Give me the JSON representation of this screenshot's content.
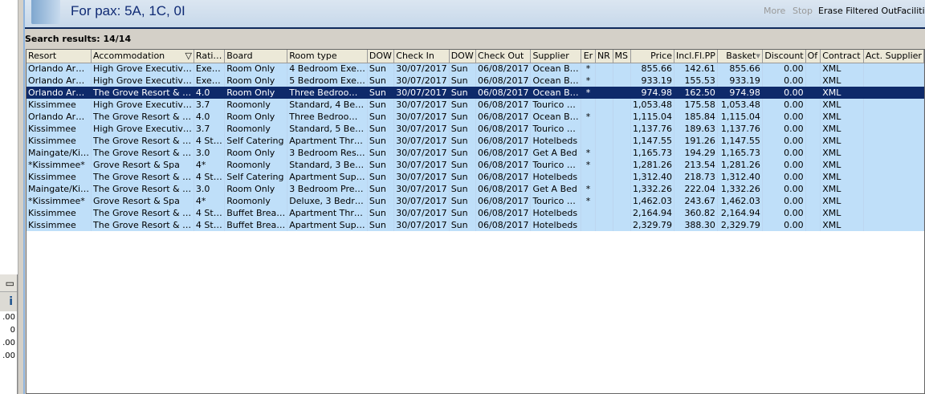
{
  "header": {
    "title": "For pax: 5A, 1C, 0I",
    "tools": [
      "More",
      "Stop",
      "Erase Filtered Out",
      "Facilities"
    ]
  },
  "results_label": "Search results: 14/14",
  "left_panel": {
    "values": [
      ".00",
      "0",
      ".00",
      ".00"
    ],
    "info_icon": "i"
  },
  "columns": [
    "Resort",
    "Accommodation",
    "Rati…",
    "Board",
    "Room type",
    "DOW",
    "Check In",
    "DOW",
    "Check Out",
    "Supplier",
    "Er",
    "NR",
    "MS",
    "Price",
    "Incl.Fl.PP",
    "Basket",
    "Discount",
    "Of",
    "Contract",
    "Act. Supplier"
  ],
  "rows": [
    [
      "Orlando Ar…",
      "High Grove Executiv…",
      "Exe…",
      "Room Only",
      "4 Bedroom Exe…",
      "Sun",
      "30/07/2017",
      "Sun",
      "06/08/2017",
      "Ocean B…",
      "*",
      "",
      "",
      "855.66",
      "142.61",
      "855.66",
      "0.00",
      "",
      "XML",
      ""
    ],
    [
      "Orlando Ar…",
      "High Grove Executiv…",
      "Exe…",
      "Room Only",
      "5 Bedroom Exe…",
      "Sun",
      "30/07/2017",
      "Sun",
      "06/08/2017",
      "Ocean B…",
      "*",
      "",
      "",
      "933.19",
      "155.53",
      "933.19",
      "0.00",
      "",
      "XML",
      ""
    ],
    [
      "Orlando Ar…",
      "The Grove Resort & …",
      "4.0",
      "Room Only",
      "Three Bedroo…",
      "Sun",
      "30/07/2017",
      "Sun",
      "06/08/2017",
      "Ocean B…",
      "*",
      "",
      "",
      "974.98",
      "162.50",
      "974.98",
      "0.00",
      "",
      "XML",
      ""
    ],
    [
      "Kissimmee",
      "High Grove Executiv…",
      "3.7",
      "Roomonly",
      "Standard, 4 Be…",
      "Sun",
      "30/07/2017",
      "Sun",
      "06/08/2017",
      "Tourico …",
      "",
      "",
      "",
      "1,053.48",
      "175.58",
      "1,053.48",
      "0.00",
      "",
      "XML",
      ""
    ],
    [
      "Orlando Ar…",
      "The Grove Resort & …",
      "4.0",
      "Room Only",
      "Three Bedroo…",
      "Sun",
      "30/07/2017",
      "Sun",
      "06/08/2017",
      "Ocean B…",
      "*",
      "",
      "",
      "1,115.04",
      "185.84",
      "1,115.04",
      "0.00",
      "",
      "XML",
      ""
    ],
    [
      "Kissimmee",
      "High Grove Executiv…",
      "3.7",
      "Roomonly",
      "Standard, 5 Be…",
      "Sun",
      "30/07/2017",
      "Sun",
      "06/08/2017",
      "Tourico …",
      "",
      "",
      "",
      "1,137.76",
      "189.63",
      "1,137.76",
      "0.00",
      "",
      "XML",
      ""
    ],
    [
      "Kissimmee",
      "The Grove Resort & …",
      "4 St…",
      "Self Catering",
      "Apartment Thr…",
      "Sun",
      "30/07/2017",
      "Sun",
      "06/08/2017",
      "Hotelbeds",
      "",
      "",
      "",
      "1,147.55",
      "191.26",
      "1,147.55",
      "0.00",
      "",
      "XML",
      ""
    ],
    [
      "Maingate/Ki…",
      "The Grove Resort & …",
      "3.0",
      "Room Only",
      "3 Bedroom Res…",
      "Sun",
      "30/07/2017",
      "Sun",
      "06/08/2017",
      "Get A Bed",
      "*",
      "",
      "",
      "1,165.73",
      "194.29",
      "1,165.73",
      "0.00",
      "",
      "XML",
      ""
    ],
    [
      "*Kissimmee*",
      "Grove Resort & Spa",
      "4*",
      "Roomonly",
      "Standard, 3 Be…",
      "Sun",
      "30/07/2017",
      "Sun",
      "06/08/2017",
      "Tourico …",
      "*",
      "",
      "",
      "1,281.26",
      "213.54",
      "1,281.26",
      "0.00",
      "",
      "XML",
      ""
    ],
    [
      "Kissimmee",
      "The Grove Resort & …",
      "4 St…",
      "Self Catering",
      "Apartment Sup…",
      "Sun",
      "30/07/2017",
      "Sun",
      "06/08/2017",
      "Hotelbeds",
      "",
      "",
      "",
      "1,312.40",
      "218.73",
      "1,312.40",
      "0.00",
      "",
      "XML",
      ""
    ],
    [
      "Maingate/Ki…",
      "The Grove Resort & …",
      "3.0",
      "Room Only",
      "3 Bedroom Pre…",
      "Sun",
      "30/07/2017",
      "Sun",
      "06/08/2017",
      "Get A Bed",
      "*",
      "",
      "",
      "1,332.26",
      "222.04",
      "1,332.26",
      "0.00",
      "",
      "XML",
      ""
    ],
    [
      "*Kissimmee*",
      "Grove Resort & Spa",
      "4*",
      "Roomonly",
      "Deluxe, 3 Bedr…",
      "Sun",
      "30/07/2017",
      "Sun",
      "06/08/2017",
      "Tourico …",
      "*",
      "",
      "",
      "1,462.03",
      "243.67",
      "1,462.03",
      "0.00",
      "",
      "XML",
      ""
    ],
    [
      "Kissimmee",
      "The Grove Resort & …",
      "4 St…",
      "Buffet Brea…",
      "Apartment Thr…",
      "Sun",
      "30/07/2017",
      "Sun",
      "06/08/2017",
      "Hotelbeds",
      "",
      "",
      "",
      "2,164.94",
      "360.82",
      "2,164.94",
      "0.00",
      "",
      "XML",
      ""
    ],
    [
      "Kissimmee",
      "The Grove Resort & …",
      "4 St…",
      "Buffet Brea…",
      "Apartment Sup…",
      "Sun",
      "30/07/2017",
      "Sun",
      "06/08/2017",
      "Hotelbeds",
      "",
      "",
      "",
      "2,329.79",
      "388.30",
      "2,329.79",
      "0.00",
      "",
      "XML",
      ""
    ]
  ],
  "selected_row": 2
}
